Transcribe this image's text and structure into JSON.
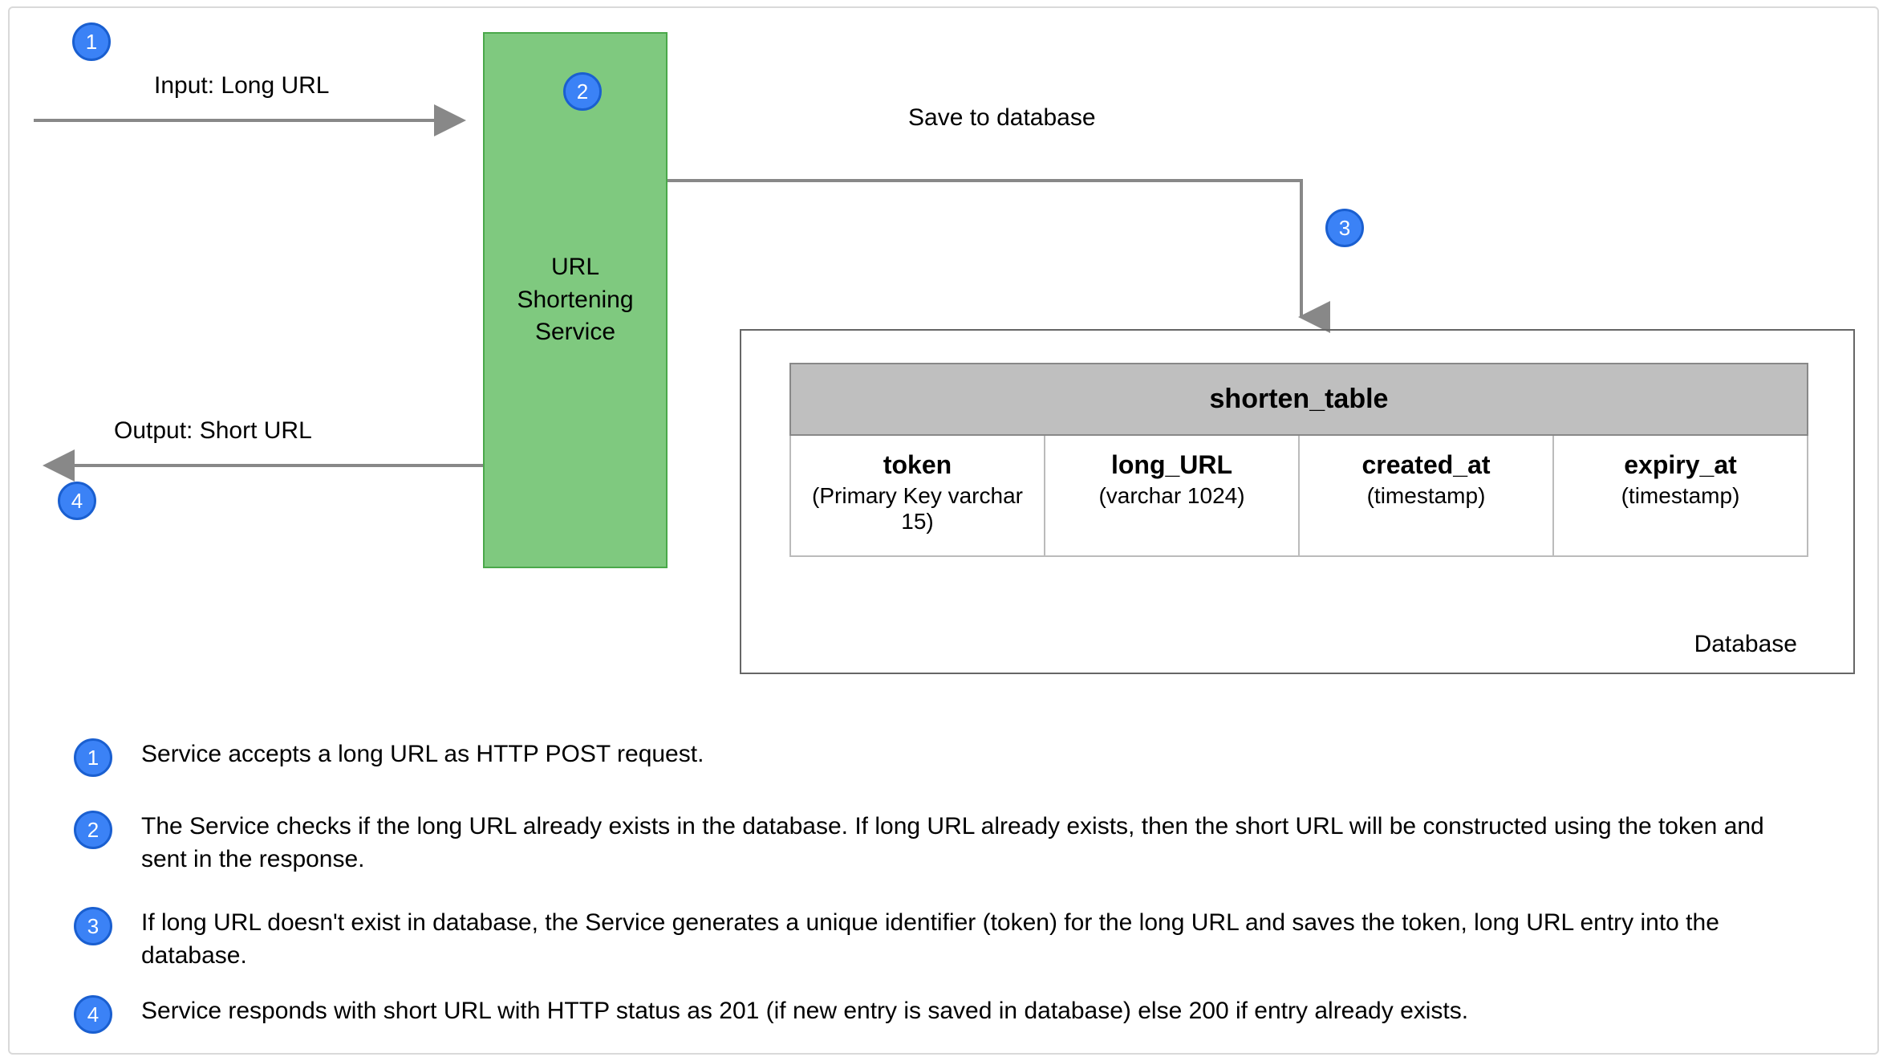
{
  "arrows": {
    "input_label": "Input: Long URL",
    "output_label": "Output: Short URL",
    "save_label": "Save to database"
  },
  "service": {
    "label": "URL\nShortening\nService"
  },
  "database": {
    "label": "Database",
    "table_name": "shorten_table",
    "columns": [
      {
        "name": "token",
        "type": "(Primary Key varchar 15)"
      },
      {
        "name": "long_URL",
        "type": "(varchar 1024)"
      },
      {
        "name": "created_at",
        "type": "(timestamp)"
      },
      {
        "name": "expiry_at",
        "type": "(timestamp)"
      }
    ]
  },
  "badges": {
    "b1": "1",
    "b2": "2",
    "b3": "3",
    "b4": "4"
  },
  "legend": {
    "s1": "Service accepts a long URL as HTTP POST request.",
    "s2": "The Service checks if the long URL already exists in the database. If long URL already exists, then the short URL will be constructed using the token and sent in the response.",
    "s3": "If long URL doesn't exist in database, the Service generates a unique identifier (token) for the long URL and saves the token, long URL entry into the database.",
    "s4": "Service responds with short URL with HTTP status as 201 (if new entry is saved in database) else 200 if entry already exists."
  }
}
